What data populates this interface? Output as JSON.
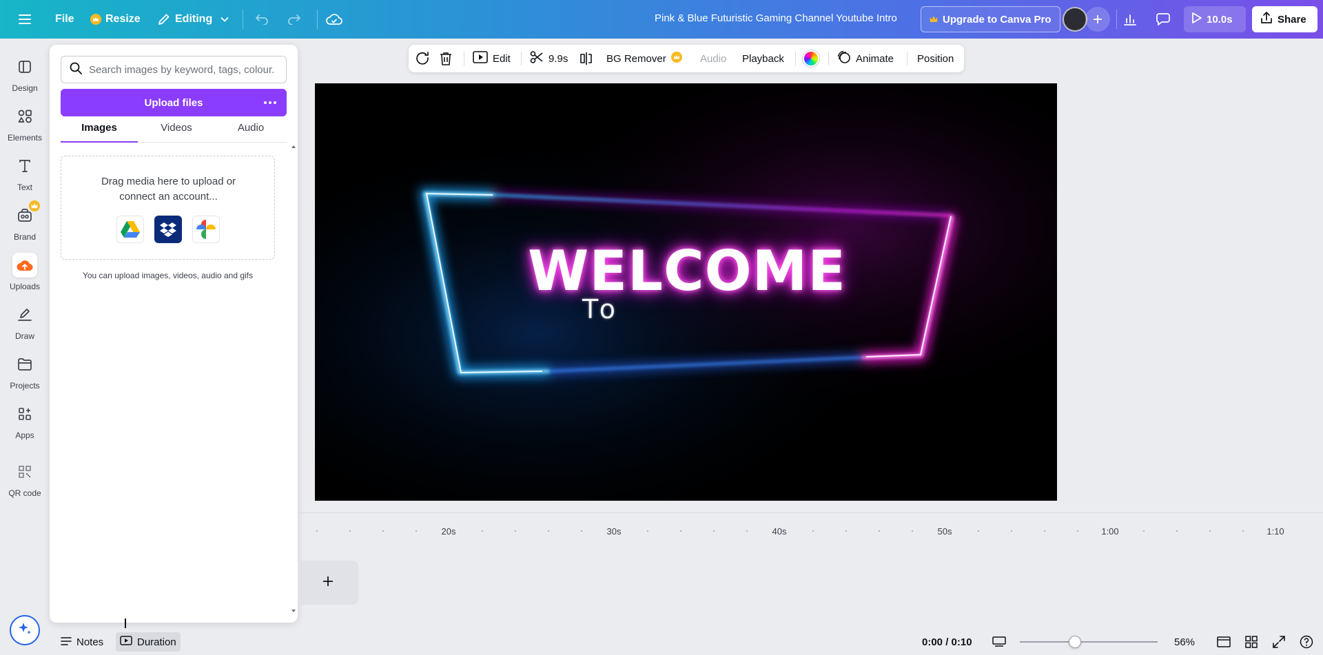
{
  "topbar": {
    "file_label": "File",
    "resize_label": "Resize",
    "editing_label": "Editing",
    "title": "Pink & Blue Futuristic Gaming Channel Youtube Intro",
    "upgrade_label": "Upgrade to Canva Pro",
    "play_label": "10.0s",
    "share_label": "Share"
  },
  "rail": {
    "items": [
      {
        "label": "Design",
        "icon": "design-icon"
      },
      {
        "label": "Elements",
        "icon": "elements-icon"
      },
      {
        "label": "Text",
        "icon": "text-icon"
      },
      {
        "label": "Brand",
        "icon": "brand-icon"
      },
      {
        "label": "Uploads",
        "icon": "uploads-icon"
      },
      {
        "label": "Draw",
        "icon": "draw-icon"
      },
      {
        "label": "Projects",
        "icon": "projects-icon"
      },
      {
        "label": "Apps",
        "icon": "apps-icon"
      },
      {
        "label": "QR code",
        "icon": "qr-code-icon"
      }
    ],
    "active": "Uploads"
  },
  "panel": {
    "search_placeholder": "Search images by keyword, tags, colour...",
    "upload_label": "Upload files",
    "tabs": [
      "Images",
      "Videos",
      "Audio"
    ],
    "active_tab": "Images",
    "dropzone_text": "Drag media here to upload or connect an account...",
    "hint": "You can upload images, videos, audio and gifs"
  },
  "canvas_toolbar": {
    "edit_label": "Edit",
    "split_label": "9.9s",
    "bg_remover_label": "BG Remover",
    "audio_label": "Audio",
    "playback_label": "Playback",
    "animate_label": "Animate",
    "position_label": "Position"
  },
  "canvas": {
    "headline": "WELCOME",
    "subline": "To"
  },
  "timeline": {
    "ticks": [
      "20s",
      "30s",
      "40s",
      "50s",
      "1:00",
      "1:10"
    ]
  },
  "bottombar": {
    "notes_label": "Notes",
    "duration_label": "Duration",
    "time": "0:00 / 0:10",
    "zoom": "56%",
    "zoom_fraction": 0.4
  },
  "colors": {
    "brand_purple": "#8b3dff",
    "neon_blue": "#1ea7ff",
    "neon_pink": "#ff1fe0"
  }
}
